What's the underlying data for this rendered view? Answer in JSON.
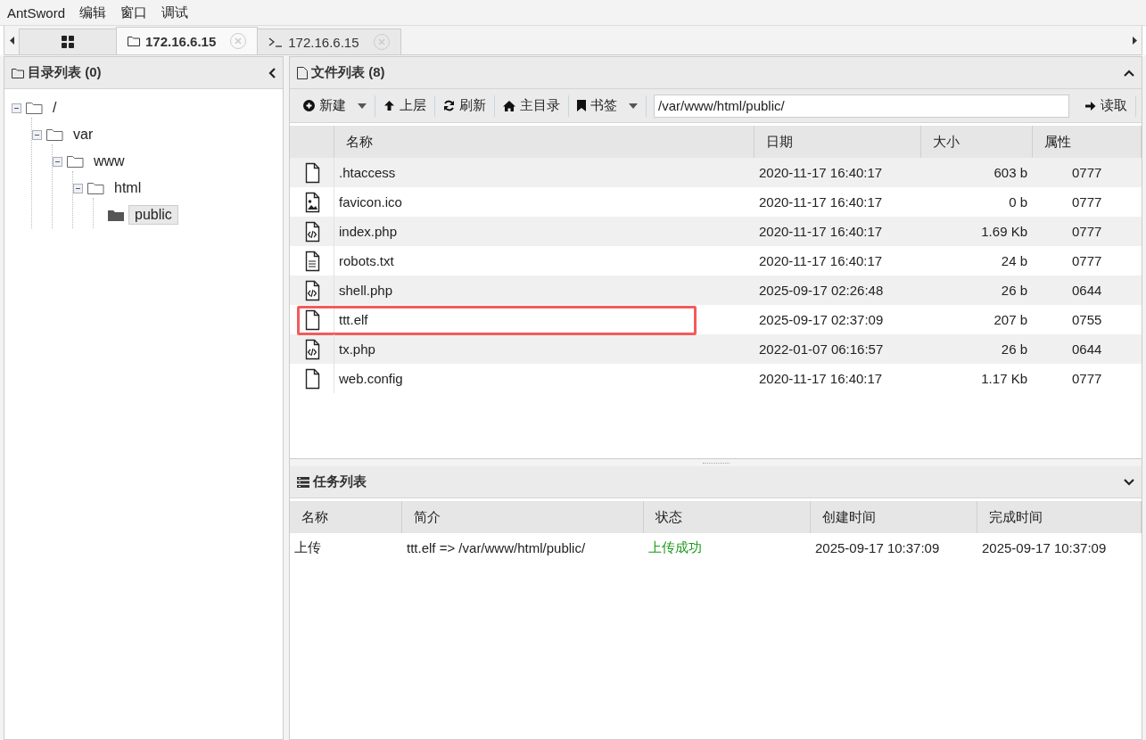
{
  "menu": [
    "AntSword",
    "编辑",
    "窗口",
    "调试"
  ],
  "tabs": [
    {
      "kind": "home",
      "selected": false
    },
    {
      "kind": "folder",
      "label": "172.16.6.15",
      "selected": true
    },
    {
      "kind": "terminal",
      "label": "172.16.6.15",
      "selected": false
    }
  ],
  "directory_panel": {
    "title": "目录列表 (0)",
    "tree": [
      {
        "label": "/",
        "selected": false,
        "children": [
          {
            "label": "var",
            "selected": false,
            "children": [
              {
                "label": "www",
                "selected": false,
                "children": [
                  {
                    "label": "html",
                    "selected": false,
                    "children": [
                      {
                        "label": "public",
                        "selected": true
                      }
                    ]
                  }
                ]
              }
            ]
          }
        ]
      }
    ]
  },
  "file_panel": {
    "title": "文件列表 (8)",
    "toolbar": [
      {
        "kind": "new",
        "label": "新建",
        "dropdown": true
      },
      {
        "kind": "up",
        "label": "上层",
        "dropdown": false
      },
      {
        "kind": "refresh",
        "label": "刷新",
        "dropdown": false
      },
      {
        "kind": "home",
        "label": "主目录",
        "dropdown": false
      },
      {
        "kind": "bookmark",
        "label": "书签",
        "dropdown": true
      }
    ],
    "path": "/var/www/html/public/",
    "read_button": "读取",
    "columns": [
      "名称",
      "日期",
      "大小",
      "属性"
    ],
    "rows": [
      {
        "kind": "file",
        "name": ".htaccess",
        "date": "2020-11-17 16:40:17",
        "size": "603 b",
        "mode": "0777",
        "highlighted": false
      },
      {
        "kind": "image",
        "name": "favicon.ico",
        "date": "2020-11-17 16:40:17",
        "size": "0 b",
        "mode": "0777",
        "highlighted": false
      },
      {
        "kind": "code",
        "name": "index.php",
        "date": "2020-11-17 16:40:17",
        "size": "1.69 Kb",
        "mode": "0777",
        "highlighted": false
      },
      {
        "kind": "text",
        "name": "robots.txt",
        "date": "2020-11-17 16:40:17",
        "size": "24 b",
        "mode": "0777",
        "highlighted": false
      },
      {
        "kind": "code",
        "name": "shell.php",
        "date": "2025-09-17 02:26:48",
        "size": "26 b",
        "mode": "0644",
        "highlighted": false
      },
      {
        "kind": "file",
        "name": "ttt.elf",
        "date": "2025-09-17 02:37:09",
        "size": "207 b",
        "mode": "0755",
        "highlighted": true
      },
      {
        "kind": "code",
        "name": "tx.php",
        "date": "2022-01-07 06:16:57",
        "size": "26 b",
        "mode": "0644",
        "highlighted": false
      },
      {
        "kind": "file",
        "name": "web.config",
        "date": "2020-11-17 16:40:17",
        "size": "1.17 Kb",
        "mode": "0777",
        "highlighted": false
      }
    ]
  },
  "task_panel": {
    "title": "任务列表",
    "columns": [
      "名称",
      "简介",
      "状态",
      "创建时间",
      "完成时间"
    ],
    "rows": [
      {
        "name": "上传",
        "summary": "ttt.elf => /var/www/html/public/",
        "status": "上传成功",
        "color": "#1a9a1a",
        "created": "2025-09-17 10:37:09",
        "finished": "2025-09-17 10:37:09"
      }
    ]
  }
}
